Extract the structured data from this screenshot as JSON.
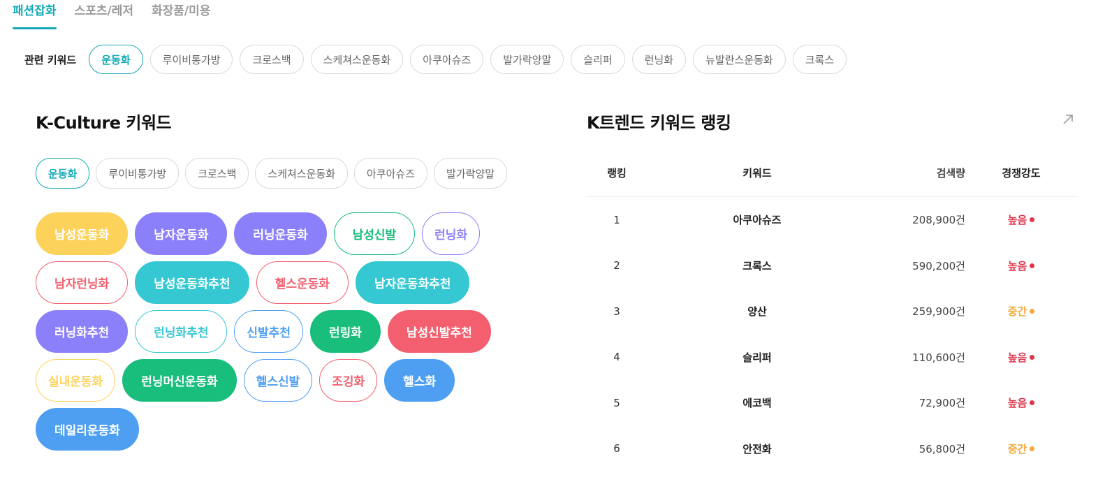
{
  "category_tabs": [
    {
      "label": "패션잡화",
      "active": true
    },
    {
      "label": "스포츠/레저",
      "active": false
    },
    {
      "label": "화장품/미용",
      "active": false
    }
  ],
  "related": {
    "label": "관련 키워드",
    "keywords": [
      "운동화",
      "루이비통가방",
      "크로스백",
      "스케쳐스운동화",
      "아쿠아슈즈",
      "발가락양말",
      "슬리퍼",
      "런닝화",
      "뉴발란스운동화",
      "크록스"
    ],
    "active_index": 0
  },
  "kculture": {
    "title": "K-Culture 키워드",
    "tabs": [
      "운동화",
      "루이비통가방",
      "크로스백",
      "스케쳐스운동화",
      "아쿠아슈즈",
      "발가락양말"
    ],
    "active_index": 0,
    "cloud": [
      {
        "label": "남성운동화",
        "color": "#fdd25a",
        "style": "filled"
      },
      {
        "label": "남자운동화",
        "color": "#8b80f9",
        "style": "filled"
      },
      {
        "label": "러닝운동화",
        "color": "#8b80f9",
        "style": "filled"
      },
      {
        "label": "남성신발",
        "color": "#19bd7c",
        "style": "outline"
      },
      {
        "label": "런닝화",
        "color": "#8b80f9",
        "style": "outline",
        "small": true
      },
      {
        "label": "남자런닝화",
        "color": "#f35f6e",
        "style": "outline"
      },
      {
        "label": "남성운동화추천",
        "color": "#35c8d2",
        "style": "filled"
      },
      {
        "label": "헬스운동화",
        "color": "#f35f6e",
        "style": "outline"
      },
      {
        "label": "남자운동화추천",
        "color": "#35c8d2",
        "style": "filled"
      },
      {
        "label": "러닝화추천",
        "color": "#8b80f9",
        "style": "filled"
      },
      {
        "label": "런닝화추천",
        "color": "#35c8d2",
        "style": "outline"
      },
      {
        "label": "신발추천",
        "color": "#4e9ff2",
        "style": "outline",
        "small": true
      },
      {
        "label": "런링화",
        "color": "#19bd7c",
        "style": "filled"
      },
      {
        "label": "남성신발추천",
        "color": "#f35f6e",
        "style": "filled"
      },
      {
        "label": "실내운동화",
        "color": "#fdd25a",
        "style": "outline",
        "small": true
      },
      {
        "label": "런닝머신운동화",
        "color": "#19bd7c",
        "style": "filled"
      },
      {
        "label": "헬스신발",
        "color": "#4e9ff2",
        "style": "outline",
        "small": true
      },
      {
        "label": "조깅화",
        "color": "#f35f6e",
        "style": "outline",
        "small": true
      },
      {
        "label": "헬스화",
        "color": "#4e9ff2",
        "style": "filled"
      },
      {
        "label": "데일리운동화",
        "color": "#4e9ff2",
        "style": "filled"
      }
    ]
  },
  "ktrend": {
    "title": "K트렌드 키워드 랭킹",
    "link_icon": "arrow-up-right-icon",
    "headers": {
      "rank": "랭킹",
      "keyword": "키워드",
      "volume": "검색량",
      "competition": "경쟁강도"
    },
    "rows": [
      {
        "rank": "1",
        "keyword": "아쿠아슈즈",
        "volume": "208,900건",
        "competition": "높음",
        "level": "high"
      },
      {
        "rank": "2",
        "keyword": "크록스",
        "volume": "590,200건",
        "competition": "높음",
        "level": "high"
      },
      {
        "rank": "3",
        "keyword": "양산",
        "volume": "259,900건",
        "competition": "중간",
        "level": "mid"
      },
      {
        "rank": "4",
        "keyword": "슬리퍼",
        "volume": "110,600건",
        "competition": "높음",
        "level": "high"
      },
      {
        "rank": "5",
        "keyword": "에코백",
        "volume": "72,900건",
        "competition": "높음",
        "level": "high"
      },
      {
        "rank": "6",
        "keyword": "안전화",
        "volume": "56,800건",
        "competition": "중간",
        "level": "mid"
      }
    ],
    "level_colors": {
      "high": "#e0344b",
      "mid": "#f4a83a"
    }
  },
  "colors": {
    "accent": "#14aab6"
  }
}
